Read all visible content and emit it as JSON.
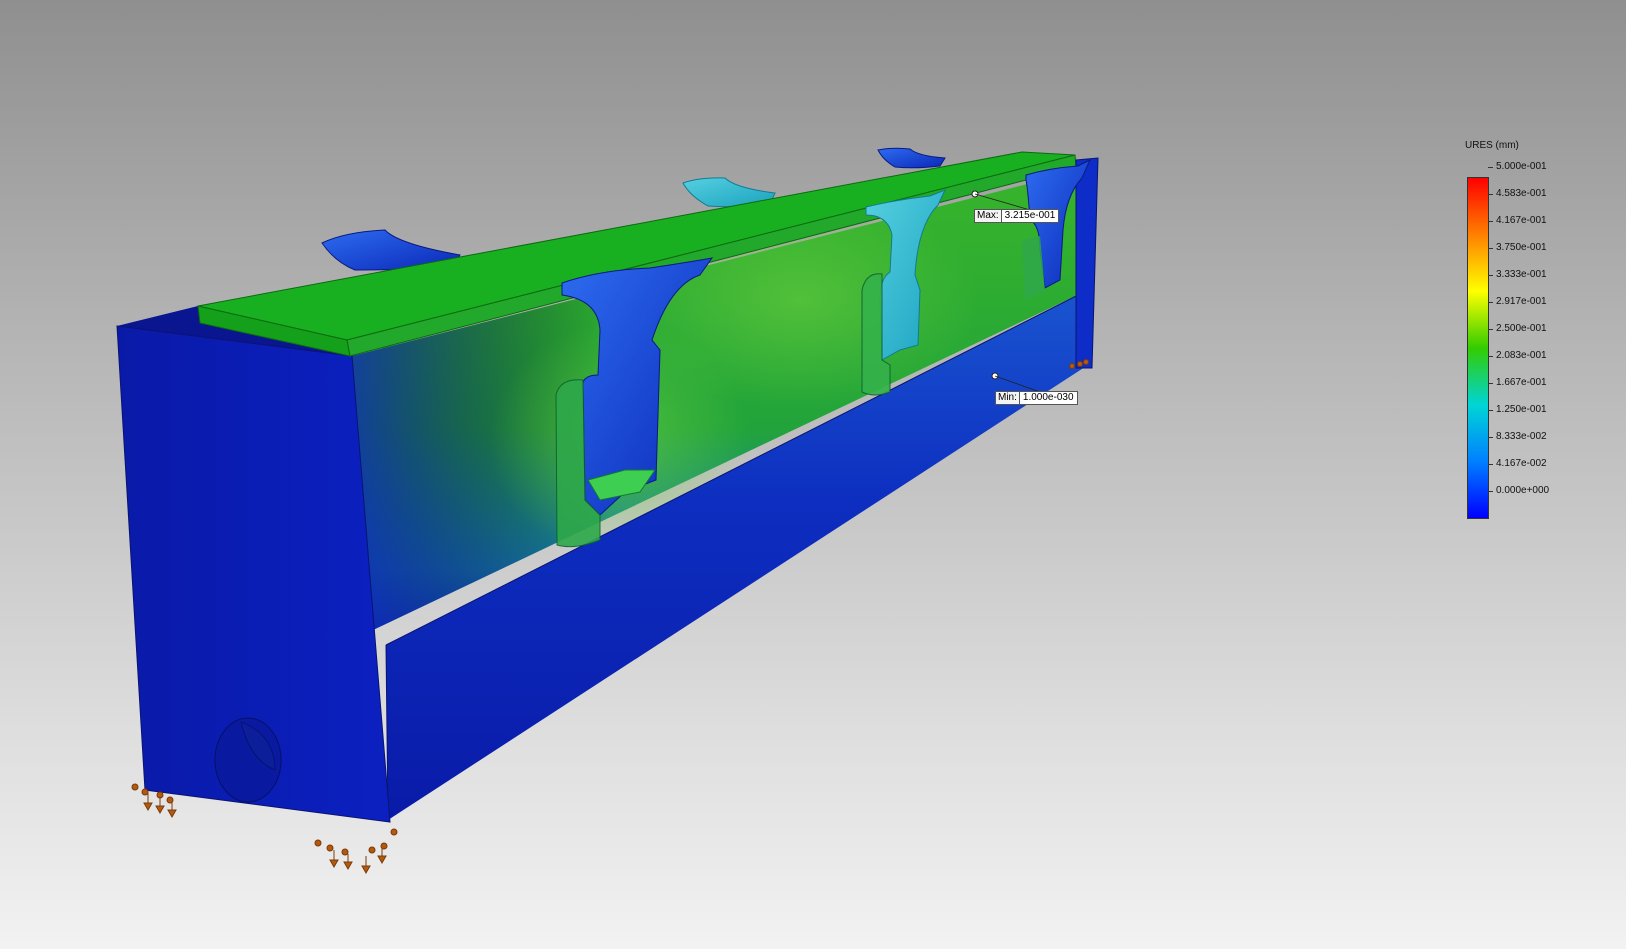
{
  "legend": {
    "title": "URES (mm)",
    "labels": [
      "5.000e-001",
      "4.583e-001",
      "4.167e-001",
      "3.750e-001",
      "3.333e-001",
      "2.917e-001",
      "2.500e-001",
      "2.083e-001",
      "1.667e-001",
      "1.250e-001",
      "8.333e-002",
      "4.167e-002",
      "0.000e+000"
    ],
    "colors": [
      "#ff0000",
      "#ff8000",
      "#ffff00",
      "#33cc00",
      "#00d5d5",
      "#0080ff",
      "#0000ff"
    ]
  },
  "probes": {
    "max": {
      "label": "Max:",
      "value": "3.215e-001"
    },
    "min": {
      "label": "Min:",
      "value": "1.000e-030"
    }
  }
}
